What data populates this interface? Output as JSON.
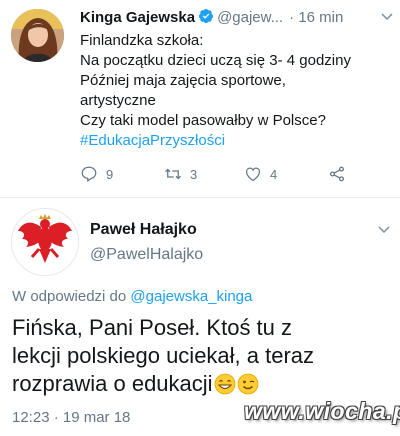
{
  "colors": {
    "link": "#1da1f2",
    "secondary_text": "#657786",
    "primary_text": "#14171a",
    "verified": "#1da1f2"
  },
  "tweet1": {
    "author_name": "Kinga Gajewska",
    "verified": true,
    "handle": "@gajew...",
    "time": "· 16 min",
    "text_lines": [
      "Finlandzka szkoła:",
      "Na początku dzieci uczą się 3- 4 godziny",
      "Później maja zajęcia sportowe,",
      "artystyczne",
      "Czy taki model pasowałby w Polsce?"
    ],
    "hashtag": "#EdukacjaPrzyszłości",
    "actions": {
      "reply_icon": "reply-icon",
      "reply_count": "9",
      "retweet_icon": "retweet-icon",
      "retweet_count": "3",
      "like_icon": "heart-icon",
      "like_count": "4",
      "share_icon": "share-icon"
    }
  },
  "tweet2": {
    "author_name": "Paweł Hałajko",
    "handle": "@PawelHalajko",
    "reply_prefix": "W odpowiedzi do",
    "reply_mention": "@gajewska_kinga",
    "text_lines": [
      "Fińska, Pani Poseł. Ktoś tu z",
      "lekcji polskiego uciekał, a teraz",
      "rozprawia o edukacji"
    ],
    "emojis": [
      "grinning-face-with-smiling-eyes",
      "winking-face"
    ],
    "timestamp": "12:23 · 19 mar 18"
  },
  "watermark": "www.wiocha.pl"
}
